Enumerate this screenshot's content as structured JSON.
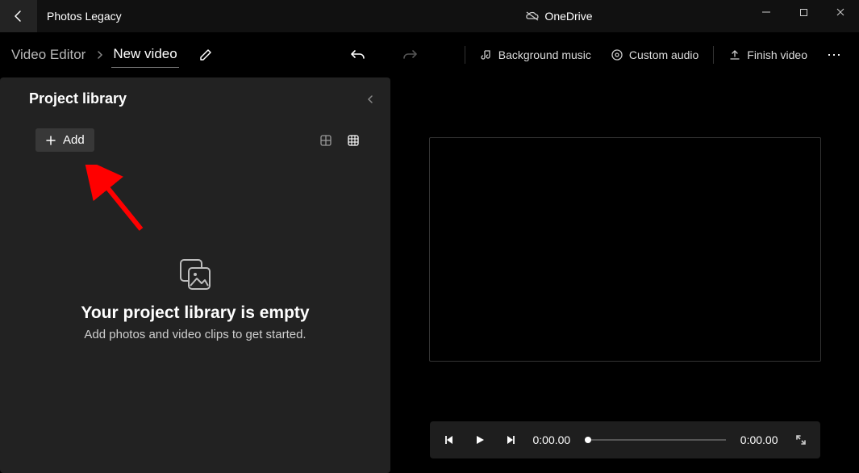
{
  "titlebar": {
    "app_title": "Photos Legacy",
    "onedrive_label": "OneDrive"
  },
  "toolbar": {
    "crumb_root": "Video Editor",
    "crumb_active": "New video",
    "bg_music": "Background music",
    "custom_audio": "Custom audio",
    "finish_video": "Finish video"
  },
  "library": {
    "title": "Project library",
    "add_label": "Add",
    "empty_title": "Your project library is empty",
    "empty_sub": "Add photos and video clips to get started."
  },
  "playbar": {
    "current_time": "0:00.00",
    "total_time": "0:00.00"
  }
}
